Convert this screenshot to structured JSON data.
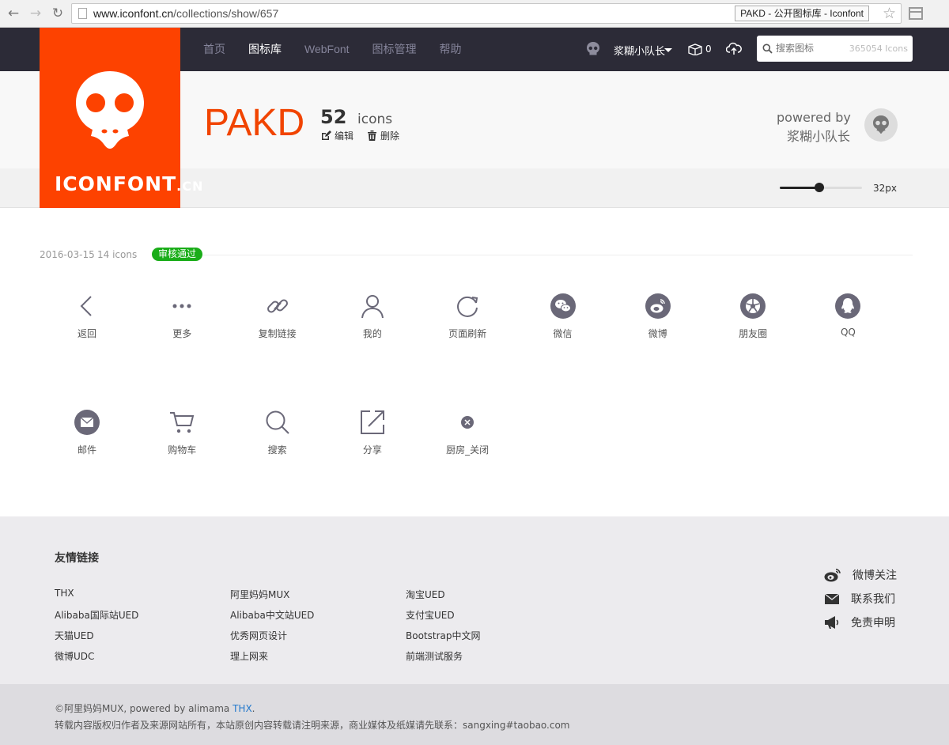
{
  "browser": {
    "url_domain": "www.iconfont.cn",
    "url_path": "/collections/show/657",
    "tab_title": "PAKD - 公开图标库 - Iconfont"
  },
  "header": {
    "nav": [
      "首页",
      "图标库",
      "WebFont",
      "图标管理",
      "帮助"
    ],
    "active_nav": "图标库",
    "username": "浆糊小队长",
    "cart_count": "0",
    "search_placeholder": "搜索图标",
    "search_count": "365054 Icons"
  },
  "logo": {
    "main": "ICONFONT",
    "suffix": ".CN"
  },
  "collection": {
    "title": "PAKD",
    "count": "52",
    "count_unit": "icons",
    "edit_label": "编辑",
    "delete_label": "删除",
    "powered_by": "powered by",
    "author": "浆糊小队长",
    "size_label": "32px",
    "size_value": 0.48
  },
  "batch": {
    "date": "2016-03-15",
    "count": "14 icons",
    "status": "审核通过",
    "status_color": "#1aad19"
  },
  "icons": [
    {
      "label": "返回",
      "icon": "arrow-left-icon"
    },
    {
      "label": "更多",
      "icon": "more-icon"
    },
    {
      "label": "复制链接",
      "icon": "link-icon"
    },
    {
      "label": "我的",
      "icon": "user-icon"
    },
    {
      "label": "页面刷新",
      "icon": "refresh-icon"
    },
    {
      "label": "微信",
      "icon": "wechat-icon"
    },
    {
      "label": "微博",
      "icon": "weibo-icon"
    },
    {
      "label": "朋友圈",
      "icon": "moments-icon"
    },
    {
      "label": "QQ",
      "icon": "qq-icon"
    },
    {
      "label": "邮件",
      "icon": "mail-icon"
    },
    {
      "label": "购物车",
      "icon": "cart-icon"
    },
    {
      "label": "搜索",
      "icon": "search-icon"
    },
    {
      "label": "分享",
      "icon": "share-icon"
    },
    {
      "label": "厨房_关闭",
      "icon": "close-circle-icon"
    }
  ],
  "footer": {
    "title": "友情链接",
    "links": [
      [
        "THX",
        "Alibaba国际站UED",
        "天猫UED",
        "微博UDC"
      ],
      [
        "阿里妈妈MUX",
        "Alibaba中文站UED",
        "优秀网页设计",
        "理上网来"
      ],
      [
        "淘宝UED",
        "支付宝UED",
        "Bootstrap中文网",
        "前端测试服务"
      ]
    ],
    "social": [
      "微博关注",
      "联系我们",
      "免责申明"
    ],
    "copyright_prefix": "©阿里妈妈MUX, powered by alimama ",
    "copyright_link": "THX",
    "copyright_suffix": ".",
    "notice": "转载内容版权归作者及来源网站所有，本站原创内容转载请注明来源，商业媒体及纸媒请先联系：sangxing#taobao.com"
  },
  "colors": {
    "brand": "#fd4200",
    "header_bg": "#2c2b37",
    "icon_color": "#6a6878"
  }
}
